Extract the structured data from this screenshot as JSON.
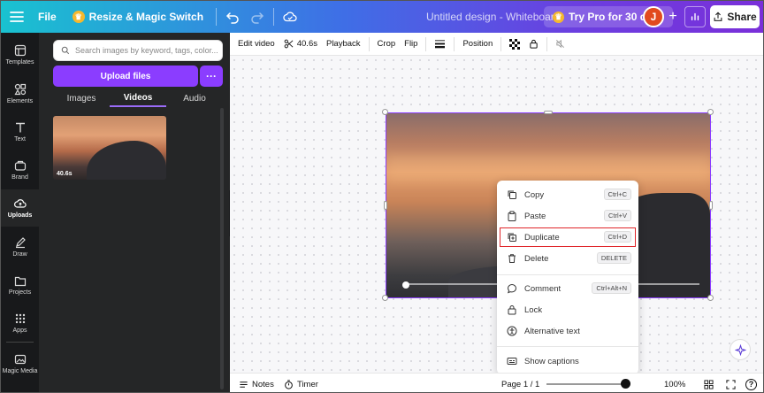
{
  "topbar": {
    "file": "File",
    "resize": "Resize & Magic Switch",
    "title": "Untitled design - Whiteboard",
    "try_pro": "Try Pro for 30 days",
    "avatar": "J",
    "share": "Share"
  },
  "rail": {
    "items": [
      {
        "label": "Templates"
      },
      {
        "label": "Elements"
      },
      {
        "label": "Text"
      },
      {
        "label": "Brand"
      },
      {
        "label": "Uploads"
      },
      {
        "label": "Draw"
      },
      {
        "label": "Projects"
      },
      {
        "label": "Apps"
      },
      {
        "label": "Magic Media"
      }
    ]
  },
  "panel": {
    "search_placeholder": "Search images by keyword, tags, color...",
    "upload_label": "Upload files",
    "more_label": "···",
    "tabs": [
      "Images",
      "Videos",
      "Audio"
    ],
    "thumb_duration": "40.6s"
  },
  "toolbar": {
    "edit_video": "Edit video",
    "duration": "40.6s",
    "playback": "Playback",
    "crop": "Crop",
    "flip": "Flip",
    "position": "Position"
  },
  "context_menu": {
    "items": [
      {
        "label": "Copy",
        "shortcut": "Ctrl+C"
      },
      {
        "label": "Paste",
        "shortcut": "Ctrl+V"
      },
      {
        "label": "Duplicate",
        "shortcut": "Ctrl+D"
      },
      {
        "label": "Delete",
        "shortcut": "DELETE"
      },
      {
        "label": "Comment",
        "shortcut": "Ctrl+Alt+N"
      },
      {
        "label": "Lock",
        "shortcut": ""
      },
      {
        "label": "Alternative text",
        "shortcut": ""
      },
      {
        "label": "Show captions",
        "shortcut": ""
      }
    ]
  },
  "bottombar": {
    "notes": "Notes",
    "timer": "Timer",
    "page": "Page 1 / 1",
    "zoom": "100%",
    "help": "?"
  },
  "colors": {
    "accent": "#8b3dff",
    "highlight": "#e0262b"
  }
}
